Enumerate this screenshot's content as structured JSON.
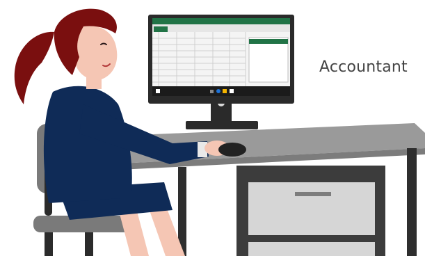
{
  "caption": {
    "text": "Accountant"
  },
  "colors": {
    "suit": "#0f2b57",
    "hair": "#7a0f0f",
    "skin": "#f5c6b4",
    "desk_top": "#9a9a9a",
    "desk_body": "#3c3c3c",
    "drawer": "#d6d6d6",
    "chair": "#7a7a7a",
    "monitor_frame": "#2a2a2a",
    "spreadsheet_header": "#217346",
    "taskbar": "#1b1b1b"
  },
  "icons": {
    "taskbar": [
      "start-icon",
      "search-icon",
      "edge-icon",
      "folder-icon",
      "store-icon"
    ]
  }
}
